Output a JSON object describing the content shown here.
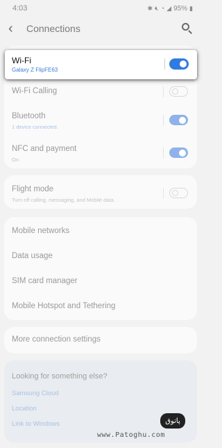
{
  "status": {
    "time": "4:03",
    "battery": "95%"
  },
  "header": {
    "title": "Connections",
    "back_icon": "back-arrow-icon",
    "search_icon": "search-icon"
  },
  "wifi": {
    "label": "Wi-Fi",
    "network": "Galaxy Z FlipFE63",
    "enabled": true,
    "accent": "#2f7be0"
  },
  "card1": {
    "items": [
      {
        "label": "Wi-Fi Calling",
        "sub": "",
        "enabled": false
      },
      {
        "label": "Bluetooth",
        "sub": "1 device connected.",
        "enabled": true
      },
      {
        "label": "NFC and payment",
        "sub": "On",
        "enabled": true
      }
    ]
  },
  "flight": {
    "label": "Flight mode",
    "sub": "Turn off calling, messaging, and Mobile data.",
    "enabled": false
  },
  "card3": {
    "items": [
      "Mobile networks",
      "Data usage",
      "SIM card manager",
      "Mobile Hotspot and Tethering"
    ]
  },
  "more": {
    "label": "More connection settings"
  },
  "help": {
    "title": "Looking for something else?",
    "links": [
      "Samsung Cloud",
      "Location",
      "Link to Windows"
    ]
  },
  "watermark": {
    "text": "www.Patoghu.com",
    "logo_text": "پاتوق"
  }
}
